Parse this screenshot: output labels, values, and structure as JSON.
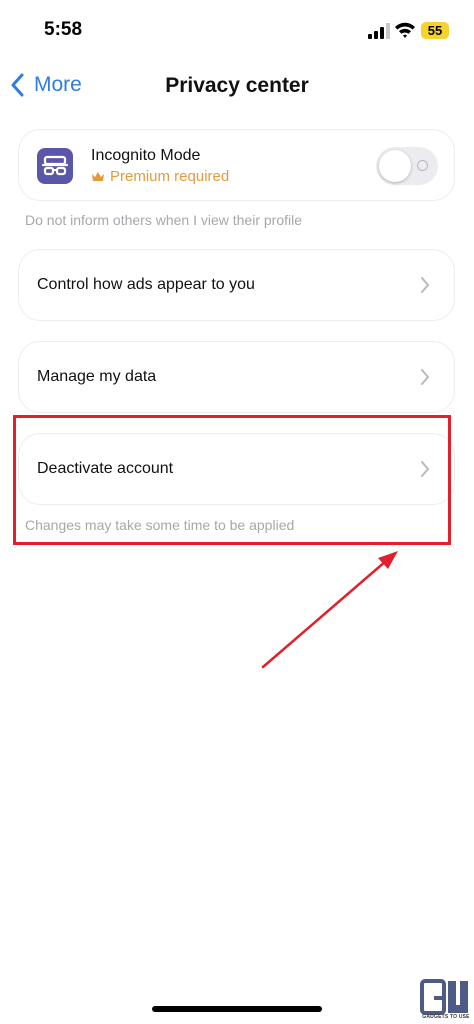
{
  "status_bar": {
    "time": "5:58",
    "battery": "55",
    "icons": [
      "signal-icon",
      "wifi-icon",
      "battery-icon"
    ]
  },
  "nav": {
    "back_label": "More",
    "title": "Privacy center"
  },
  "incognito": {
    "title": "Incognito Mode",
    "premium_text": "Premium required",
    "toggle_on": false,
    "note": "Do not inform others when I view their profile"
  },
  "rows": [
    {
      "label": "Control how ads appear to you"
    },
    {
      "label": "Manage my data"
    },
    {
      "label": "Deactivate account"
    }
  ],
  "footer_note": "Changes may take some time to be applied",
  "watermark": {
    "text": "GADGETS TO USE"
  },
  "colors": {
    "accent": "#2f7de1",
    "premium": "#e49a3c",
    "icon_bg": "#5b56a8",
    "highlight": "#e0202a",
    "note": "#a7a7ad"
  }
}
